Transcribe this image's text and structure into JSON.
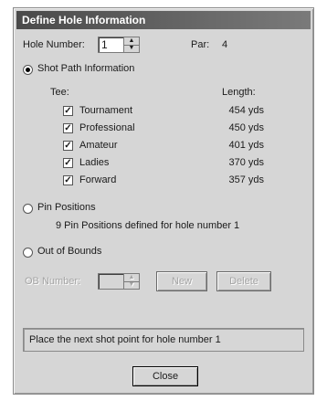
{
  "window": {
    "title": "Define Hole Information"
  },
  "hole": {
    "label": "Hole Number:",
    "value": "1",
    "par_label": "Par:",
    "par_value": "4"
  },
  "shot_path": {
    "label": "Shot Path Information",
    "selected": true,
    "tee_header": "Tee:",
    "length_header": "Length:",
    "tees": [
      {
        "name": "Tournament",
        "checked": true,
        "length": "454 yds"
      },
      {
        "name": "Professional",
        "checked": true,
        "length": "450 yds"
      },
      {
        "name": "Amateur",
        "checked": true,
        "length": "401 yds"
      },
      {
        "name": "Ladies",
        "checked": true,
        "length": "370 yds"
      },
      {
        "name": "Forward",
        "checked": true,
        "length": "357 yds"
      }
    ]
  },
  "pin_positions": {
    "label": "Pin Positions",
    "selected": false,
    "info": "9 Pin Positions defined for hole number 1"
  },
  "out_of_bounds": {
    "label": "Out of Bounds",
    "selected": false,
    "ob_label": "OB Number:",
    "ob_value": "",
    "new_label": "New",
    "delete_label": "Delete"
  },
  "status_text": "Place the next shot point for hole number 1",
  "close_label": "Close"
}
